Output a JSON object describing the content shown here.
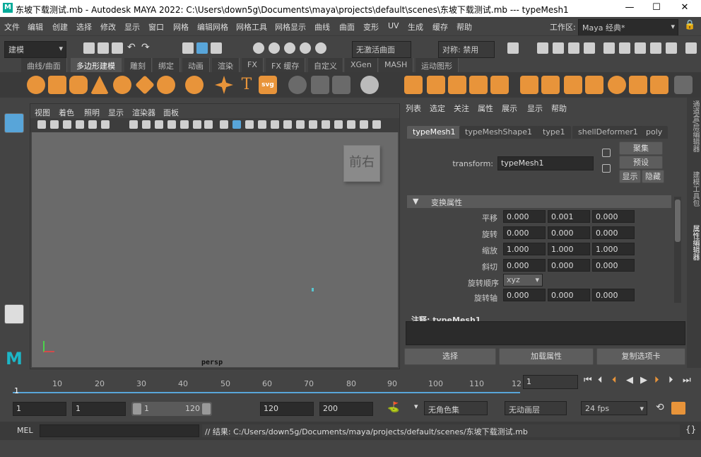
{
  "titlebar": {
    "title": "东坡下载测试.mb - Autodesk MAYA 2022: C:\\Users\\down5g\\Documents\\maya\\projects\\default\\scenes\\东坡下载测试.mb   ---   typeMesh1",
    "minimize": "—",
    "maximize": "☐",
    "close": "✕"
  },
  "menu": [
    "文件",
    "编辑",
    "创建",
    "选择",
    "修改",
    "显示",
    "窗口",
    "网格",
    "编辑网格",
    "网格工具",
    "网格显示",
    "曲线",
    "曲面",
    "变形",
    "UV",
    "生成",
    "缓存",
    "帮助"
  ],
  "workspace": {
    "label": "工作区:",
    "value": "Maya 经典*"
  },
  "shelfbar": {
    "mode": "建模",
    "live": "无激活曲面",
    "symmetry": "对称: 禁用"
  },
  "shelf_tabs": [
    "曲线/曲面",
    "多边形建模",
    "雕刻",
    "绑定",
    "动画",
    "渲染",
    "FX",
    "FX 缓存",
    "自定义",
    "XGen",
    "MASH",
    "运动图形"
  ],
  "shelf_active": 1,
  "viewport": {
    "menu": [
      "视图",
      "着色",
      "照明",
      "显示",
      "渲染器",
      "面板"
    ],
    "cube_front": "前",
    "cube_right": "右",
    "camera": "persp"
  },
  "attr": {
    "menu": [
      "列表",
      "选定",
      "关注",
      "属性",
      "展示",
      "显示",
      "帮助"
    ],
    "tabs": [
      "typeMesh1",
      "typeMeshShape1",
      "type1",
      "shellDeformer1",
      "poly"
    ],
    "transform_label": "transform:",
    "transform_value": "typeMesh1",
    "btn_focus": "聚集",
    "btn_preset": "预设",
    "btn_show": "显示",
    "btn_hide": "隐藏",
    "section": "变换属性",
    "rows": [
      {
        "label": "平移",
        "v": [
          "0.000",
          "0.001",
          "0.000"
        ]
      },
      {
        "label": "旋转",
        "v": [
          "0.000",
          "0.000",
          "0.000"
        ]
      },
      {
        "label": "缩放",
        "v": [
          "1.000",
          "1.000",
          "1.000"
        ]
      },
      {
        "label": "斜切",
        "v": [
          "0.000",
          "0.000",
          "0.000"
        ]
      }
    ],
    "rotate_order_label": "旋转顺序",
    "rotate_order": "xyz",
    "rotate_axis": {
      "label": "旋转轴",
      "v": [
        "0.000",
        "0.000",
        "0.000"
      ]
    },
    "notes_label": "注释:",
    "notes_value": "typeMesh1",
    "btn_select": "选择",
    "btn_load": "加载属性",
    "btn_copy": "复制选项卡"
  },
  "side_tabs": [
    "通道盒/层编辑器",
    "建模工具包",
    "属性编辑器"
  ],
  "timeline": {
    "ticks": [
      "1",
      "10",
      "20",
      "30",
      "40",
      "50",
      "60",
      "70",
      "80",
      "90",
      "100",
      "110",
      "12"
    ],
    "current": "1",
    "current_frame": "1"
  },
  "range": {
    "start": "1",
    "anim_start": "1",
    "slider_start": "1",
    "slider_end": "120",
    "anim_end": "120",
    "end": "200",
    "char_set": "无角色集",
    "anim_layer": "无动画层",
    "fps": "24 fps"
  },
  "cmd": {
    "label": "MEL",
    "result": "// 结果: C:/Users/down5g/Documents/maya/projects/default/scenes/东坡下载测试.mb"
  },
  "colors": {
    "accent": "#58a5d9",
    "shelf_icon": "#e8943a"
  }
}
